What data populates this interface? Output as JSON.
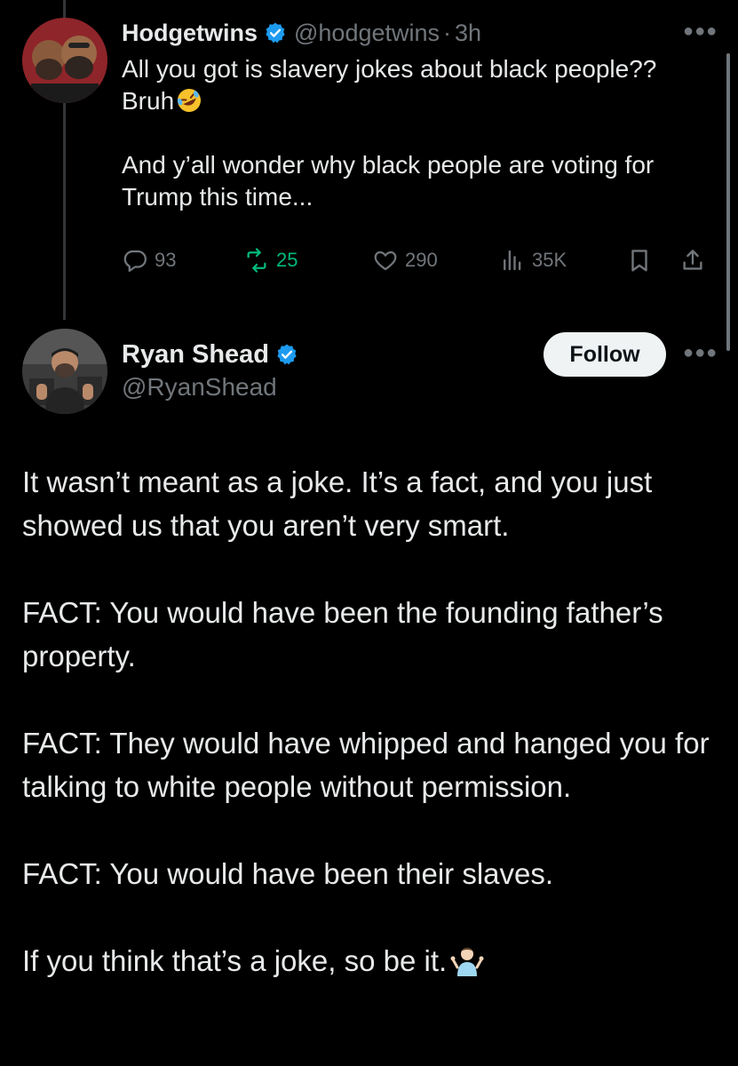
{
  "reply": {
    "name": "Hodgetwins",
    "handle": "@hodgetwins",
    "separator": "·",
    "time": "3h",
    "text": "All you got is slavery jokes about black people?? Bruh",
    "text_emoji": "rolling-on-floor-laughing",
    "text2": "And y’all wonder why black people are voting for Trump this time...",
    "stats": {
      "replies": "93",
      "retweets": "25",
      "likes": "290",
      "views": "35K"
    }
  },
  "main": {
    "name": "Ryan Shead",
    "handle": "@RyanShead",
    "follow_label": "Follow",
    "paragraphs": [
      "It wasn’t meant as a joke. It’s a fact, and you just showed us that you aren’t very smart.",
      "FACT: You would have been the founding father’s property.",
      "FACT: They would have whipped and hanged you for talking to white people without permission.",
      "FACT: You would have been their slaves.",
      "If you think that’s a joke, so be it."
    ],
    "end_emoji": "person-shrugging"
  },
  "icons": {
    "verified": "verified-badge-icon",
    "reply": "reply-icon",
    "retweet": "retweet-icon",
    "like": "heart-icon",
    "views": "views-icon",
    "bookmark": "bookmark-icon",
    "share": "share-icon",
    "more": "more-icon"
  },
  "colors": {
    "background": "#000000",
    "text": "#e7e9ea",
    "muted": "#71767b",
    "verified": "#1d9bf0",
    "retweet_active": "#00ba7c"
  }
}
